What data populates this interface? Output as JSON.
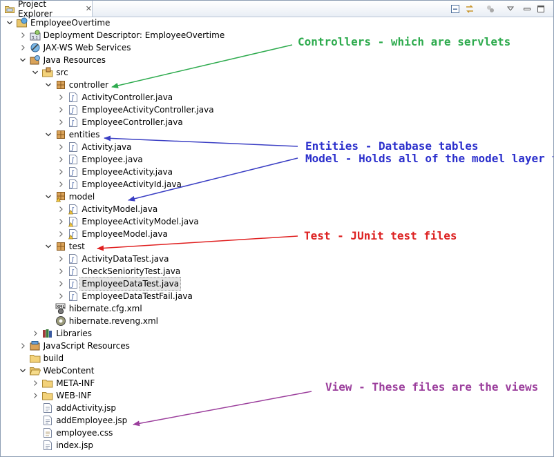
{
  "panel": {
    "title": "Project Explorer",
    "close_glyph": "✕",
    "toolbar": [
      "collapse-all-icon",
      "link-with-editor-icon",
      "focus-icon",
      "view-menu-icon",
      "minimize-icon",
      "maximize-icon"
    ]
  },
  "tree": [
    {
      "label": "EmployeeOvertime",
      "icon": "web-project-icon",
      "twisty": "open",
      "depth": 0
    },
    {
      "label": "Deployment Descriptor: EmployeeOvertime",
      "icon": "deployment-descriptor-icon",
      "twisty": "closed",
      "depth": 1
    },
    {
      "label": "JAX-WS Web Services",
      "icon": "web-services-icon",
      "twisty": "closed",
      "depth": 1
    },
    {
      "label": "Java Resources",
      "icon": "java-resources-icon",
      "twisty": "open",
      "depth": 1
    },
    {
      "label": "src",
      "icon": "source-folder-icon",
      "twisty": "open",
      "depth": 2
    },
    {
      "label": "controller",
      "icon": "package-icon",
      "twisty": "open",
      "depth": 3
    },
    {
      "label": "ActivityController.java",
      "icon": "java-file-icon",
      "twisty": "closed",
      "depth": 4
    },
    {
      "label": "EmployeeActivityController.java",
      "icon": "java-file-icon",
      "twisty": "closed",
      "depth": 4
    },
    {
      "label": "EmployeeController.java",
      "icon": "java-file-icon",
      "twisty": "closed",
      "depth": 4
    },
    {
      "label": "entities",
      "icon": "package-icon",
      "twisty": "open",
      "depth": 3
    },
    {
      "label": "Activity.java",
      "icon": "java-file-icon",
      "twisty": "closed",
      "depth": 4
    },
    {
      "label": "Employee.java",
      "icon": "java-file-icon",
      "twisty": "closed",
      "depth": 4
    },
    {
      "label": "EmployeeActivity.java",
      "icon": "java-file-icon",
      "twisty": "closed",
      "depth": 4
    },
    {
      "label": "EmployeeActivityId.java",
      "icon": "java-file-icon",
      "twisty": "closed",
      "depth": 4
    },
    {
      "label": "model",
      "icon": "package-warning-icon",
      "twisty": "open",
      "depth": 3
    },
    {
      "label": "ActivityModel.java",
      "icon": "java-file-warning-icon",
      "twisty": "closed",
      "depth": 4
    },
    {
      "label": "EmployeeActivityModel.java",
      "icon": "java-file-warning-icon",
      "twisty": "closed",
      "depth": 4
    },
    {
      "label": "EmployeeModel.java",
      "icon": "java-file-warning-icon",
      "twisty": "closed",
      "depth": 4
    },
    {
      "label": "test",
      "icon": "package-icon",
      "twisty": "open",
      "depth": 3
    },
    {
      "label": "ActivityDataTest.java",
      "icon": "java-file-icon",
      "twisty": "closed",
      "depth": 4
    },
    {
      "label": "CheckSeniorityTest.java",
      "icon": "java-file-icon",
      "twisty": "closed",
      "depth": 4
    },
    {
      "label": "EmployeeDataTest.java",
      "icon": "java-file-icon",
      "twisty": "closed",
      "depth": 4,
      "selected": true
    },
    {
      "label": "EmployeeDataTestFail.java",
      "icon": "java-file-icon",
      "twisty": "closed",
      "depth": 4
    },
    {
      "label": "hibernate.cfg.xml",
      "icon": "xml-file-icon",
      "twisty": "none",
      "depth": 3
    },
    {
      "label": "hibernate.reveng.xml",
      "icon": "reveng-file-icon",
      "twisty": "none",
      "depth": 3
    },
    {
      "label": "Libraries",
      "icon": "libraries-icon",
      "twisty": "closed",
      "depth": 2
    },
    {
      "label": "JavaScript Resources",
      "icon": "javascript-resources-icon",
      "twisty": "closed",
      "depth": 1
    },
    {
      "label": "build",
      "icon": "folder-icon",
      "twisty": "none",
      "depth": 1
    },
    {
      "label": "WebContent",
      "icon": "folder-open-icon",
      "twisty": "open",
      "depth": 1
    },
    {
      "label": "META-INF",
      "icon": "folder-icon",
      "twisty": "closed",
      "depth": 2
    },
    {
      "label": "WEB-INF",
      "icon": "folder-icon",
      "twisty": "closed",
      "depth": 2
    },
    {
      "label": "addActivity.jsp",
      "icon": "jsp-file-icon",
      "twisty": "none",
      "depth": 2
    },
    {
      "label": "addEmployee.jsp",
      "icon": "jsp-file-icon",
      "twisty": "none",
      "depth": 2
    },
    {
      "label": "employee.css",
      "icon": "css-file-icon",
      "twisty": "none",
      "depth": 2
    },
    {
      "label": "index.jsp",
      "icon": "jsp-file-icon",
      "twisty": "none",
      "depth": 2
    }
  ],
  "annotations": [
    {
      "id": "controllers",
      "text": "Controllers - which are servlets",
      "color": "#2eab4e"
    },
    {
      "id": "entities",
      "text": "Entities - Database tables",
      "color": "#2b2fcc"
    },
    {
      "id": "model",
      "text": "Model - Holds all of the model layer funct",
      "color": "#2b2fcc"
    },
    {
      "id": "test",
      "text": "Test - JUnit test files",
      "color": "#dd2222"
    },
    {
      "id": "view",
      "text": "View - These files are the views",
      "color": "#9b3e9c"
    }
  ],
  "colors": {
    "arrow_green": "#2eab4e",
    "arrow_blue": "#3b3fc4",
    "arrow_red": "#e02020",
    "arrow_purple": "#9b3e9c"
  }
}
